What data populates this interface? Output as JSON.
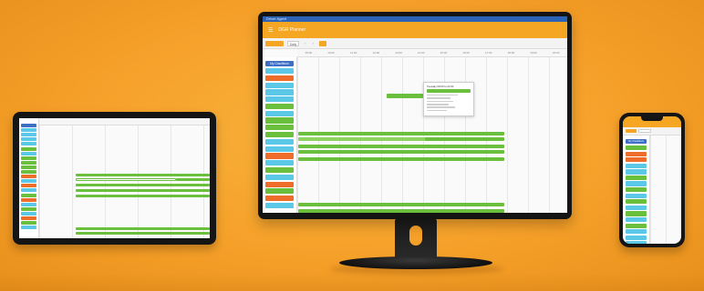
{
  "colors": {
    "background": "#f5a029",
    "brand_orange": "#f5a623",
    "event_green": "#6abf3c",
    "resource_cyan": "#5ac8e6",
    "resource_orange": "#ef6d2a",
    "header_blue": "#2d63b5"
  },
  "monitor": {
    "os_title": "Driver Agent",
    "app_title": "DGR Planner",
    "toolbar": {
      "date_button": "",
      "view_button": "Daily",
      "nav_icons": [
        "chevron-left-icon",
        "chevron-right-icon"
      ],
      "action_icon": "grid-icon"
    },
    "timeline_hours": [
      "09:00",
      "10:00",
      "11:00",
      "12:00",
      "13:00",
      "14:00",
      "15:00",
      "16:00",
      "17:00",
      "18:00",
      "19:00",
      "20:00"
    ],
    "sidebar_title": "My Chauffeurs",
    "resources": [
      "cyan",
      "orange",
      "cyan",
      "cyan",
      "cyan",
      "green",
      "cyan",
      "green",
      "green",
      "green",
      "cyan",
      "cyan",
      "orange",
      "cyan",
      "green",
      "cyan",
      "orange",
      "green",
      "orange",
      "cyan"
    ],
    "popup": {
      "title": "Tuesday 09:00 to 21:00",
      "lines": 7
    }
  },
  "tablet": {
    "sidebar_title": "",
    "resources": [
      "blue",
      "cyan",
      "cyan",
      "cyan",
      "cyan",
      "green",
      "cyan",
      "green",
      "green",
      "green",
      "green",
      "orange",
      "cyan",
      "orange",
      "cyan",
      "green",
      "orange",
      "cyan",
      "green",
      "cyan",
      "orange",
      "green",
      "cyan"
    ]
  },
  "phone": {
    "sidebar_title": "My Chauffeurs",
    "resources": [
      "green",
      "orange",
      "orange",
      "cyan",
      "cyan",
      "green",
      "cyan",
      "green",
      "cyan",
      "green",
      "cyan",
      "green",
      "cyan",
      "green",
      "cyan",
      "cyan",
      "cyan"
    ]
  }
}
